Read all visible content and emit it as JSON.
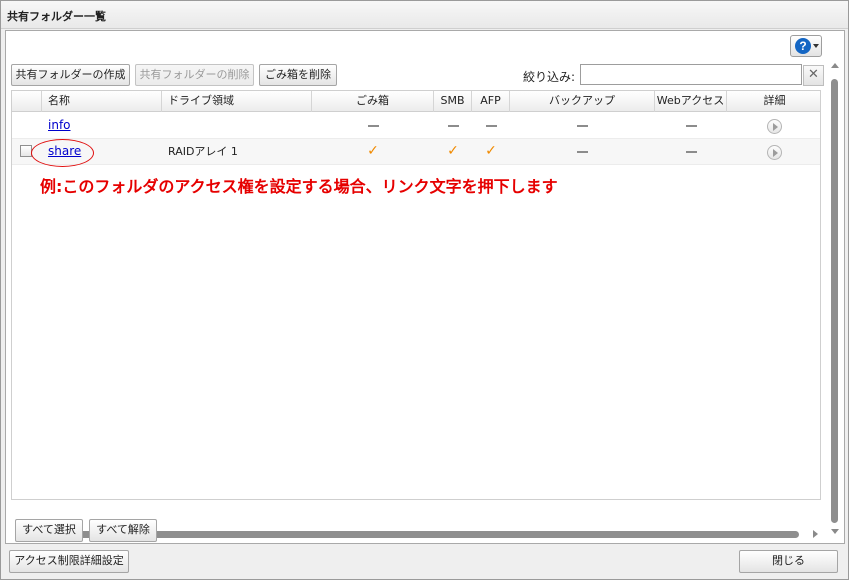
{
  "window": {
    "title": "共有フォルダー一覧"
  },
  "toolbar": {
    "create_label": "共有フォルダーの作成",
    "delete_label": "共有フォルダーの削除",
    "trash_label": "ごみ箱を削除",
    "filter_label": "絞り込み:",
    "filter_value": "",
    "help_symbol": "?"
  },
  "table": {
    "columns": [
      "名称",
      "ドライブ領域",
      "ごみ箱",
      "SMB",
      "AFP",
      "バックアップ",
      "Webアクセス",
      "詳細"
    ],
    "rows": [
      {
        "name": "info",
        "drive": "",
        "trash": "none",
        "smb": "none",
        "afp": "none",
        "backup": "none",
        "web": "none"
      },
      {
        "name": "share",
        "drive": "RAIDアレイ 1",
        "trash": "check",
        "smb": "check",
        "afp": "check",
        "backup": "none",
        "web": "none"
      }
    ]
  },
  "annotation": {
    "text": "例:このフォルダのアクセス権を設定する場合、リンク文字を押下します",
    "color": "#e60000"
  },
  "selection": {
    "select_all_label": "すべて選択",
    "deselect_all_label": "すべて解除"
  },
  "footer": {
    "access_settings_label": "アクセス制限詳細設定",
    "close_label": "閉じる"
  },
  "icons": {
    "check_glyph": "✓",
    "clear_glyph": "✕",
    "help": "help-icon",
    "detail": "play-icon",
    "none": "dash-icon"
  },
  "colors": {
    "link": "#0000cc",
    "check": "#f08a00",
    "help": "#1466c4"
  }
}
